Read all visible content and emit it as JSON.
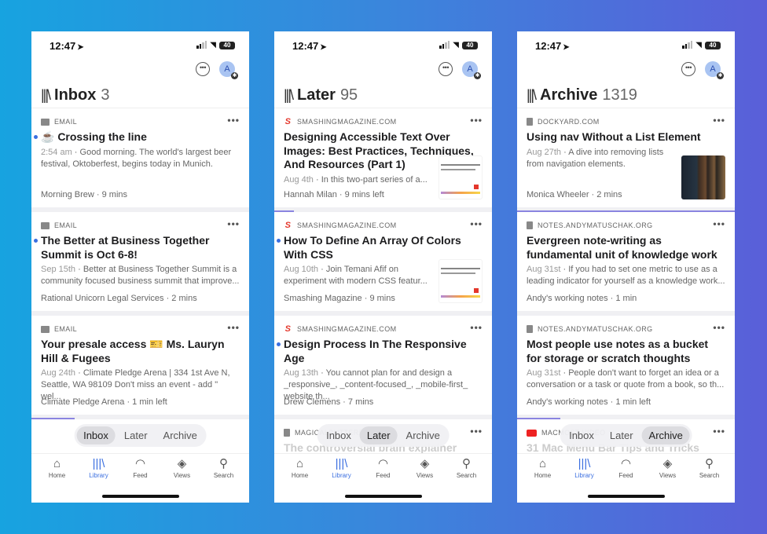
{
  "status": {
    "time": "12:47",
    "battery": "40"
  },
  "segment_labels": [
    "Inbox",
    "Later",
    "Archive"
  ],
  "nav": [
    {
      "label": "Home",
      "icon": "home-icon"
    },
    {
      "label": "Library",
      "icon": "library-icon",
      "active": true
    },
    {
      "label": "Feed",
      "icon": "feed-icon"
    },
    {
      "label": "Views",
      "icon": "layers-icon"
    },
    {
      "label": "Search",
      "icon": "search-icon"
    }
  ],
  "colors": {
    "accent": "#3b6fe0",
    "progress": "#8a84e0",
    "unread_dot": "#3b6fe0"
  },
  "screens": [
    {
      "title": "Inbox",
      "count": "3",
      "active_segment": 0,
      "items": [
        {
          "source": "EMAIL",
          "source_icon": "email",
          "unread": true,
          "title": "☕ Crossing the line",
          "date": "2:54 am",
          "snippet": "Good morning. The world's largest beer festival, Oktoberfest, begins today in Munich.",
          "footer": "Morning Brew · 9 mins"
        },
        {
          "source": "EMAIL",
          "source_icon": "email",
          "unread": true,
          "title": "The Better at Business Together Summit is Oct 6-8!",
          "date": "Sep 15th",
          "snippet": "Better at Business Together Summit is a community focused business summit that improve...",
          "footer": "Rational Unicorn Legal Services · 2 mins"
        },
        {
          "source": "EMAIL",
          "source_icon": "email",
          "unread": false,
          "title": "Your presale access 🎫 Ms. Lauryn Hill & Fugees",
          "date": "Aug 24th",
          "snippet": "Climate Pledge Arena | 334 1st Ave N, Seattle, WA 98109 Don't miss an event - add \" wel...",
          "footer": "Climate Pledge Arena · 1 min left",
          "progress": 0.2
        }
      ]
    },
    {
      "title": "Later",
      "count": "95",
      "active_segment": 1,
      "items": [
        {
          "source": "SMASHINGMAGAZINE.COM",
          "source_icon": "smashing",
          "unread": false,
          "title": "Designing Accessible Text Over Images: Best Practices, Techniques, And Resources (Part 1)",
          "date": "Aug 4th",
          "snippet": "In this two-part series of a...",
          "footer": "Hannah Milan · 9 mins left",
          "thumbnail": "smashing",
          "progress": 0.09
        },
        {
          "source": "SMASHINGMAGAZINE.COM",
          "source_icon": "smashing",
          "unread": true,
          "title": "How To Define An Array Of Colors With CSS",
          "date": "Aug 10th",
          "snippet": "Join Temani Afif on experiment with modern CSS featur...",
          "footer": "Smashing Magazine · 9 mins",
          "thumbnail": "smashing"
        },
        {
          "source": "SMASHINGMAGAZINE.COM",
          "source_icon": "smashing",
          "unread": true,
          "title": "Design Process In The Responsive Age",
          "date": "Aug 13th",
          "snippet": "You cannot plan for and design a _responsive_, _content-focused_, _mobile-first_ website th...",
          "footer": "Drew Clemens · 7 mins"
        },
        {
          "source": "MAGICALBUTTERFLY.COM",
          "source_icon": "doc",
          "unread": false,
          "title": "The controversial brain explainer",
          "ghost": true
        }
      ]
    },
    {
      "title": "Archive",
      "count": "1319",
      "active_segment": 2,
      "items": [
        {
          "source": "DOCKYARD.COM",
          "source_icon": "doc",
          "unread": false,
          "title": "Using nav Without a List Element",
          "date": "Aug 27th",
          "snippet": "A dive into removing lists from navigation elements.",
          "footer": "Monica Wheeler · 2 mins",
          "thumbnail": "books",
          "progress": 1.0
        },
        {
          "source": "NOTES.ANDYMATUSCHAK.ORG",
          "source_icon": "doc",
          "unread": false,
          "title": "Evergreen note-writing as fundamental unit of knowledge work",
          "date": "Aug 31st",
          "snippet": "If you had to set one metric to use as a leading indicator for yourself as a knowledge work...",
          "footer": "Andy's working notes · 1 min"
        },
        {
          "source": "NOTES.ANDYMATUSCHAK.ORG",
          "source_icon": "doc",
          "unread": false,
          "title": "Most people use notes as a bucket for storage or scratch thoughts",
          "date": "Aug 31st",
          "snippet": "People don't want to forget an idea or a conversation or a task or quote from a book, so th...",
          "footer": "Andy's working notes · 1 min left",
          "progress": 0.2
        },
        {
          "source": "MACMOST VIDEO",
          "source_icon": "youtube",
          "unread": false,
          "title": "31 Mac Menu Bar Tips and Tricks",
          "ghost": true
        }
      ]
    }
  ]
}
